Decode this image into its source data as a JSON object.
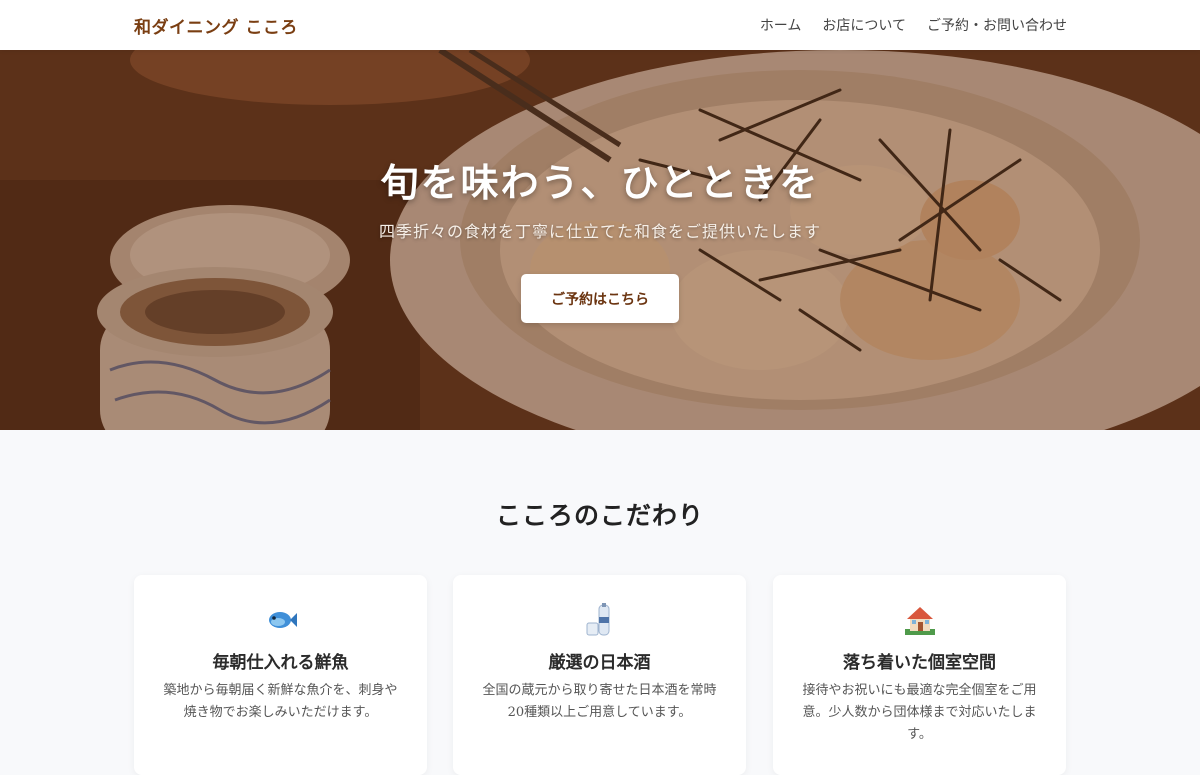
{
  "header": {
    "logo": "和ダイニング こころ",
    "nav": [
      {
        "label": "ホーム"
      },
      {
        "label": "お店について"
      },
      {
        "label": "ご予約・お問い合わせ"
      }
    ]
  },
  "hero": {
    "title": "旬を味わう、ひとときを",
    "subtitle": "四季折々の食材を丁寧に仕立てた和食をご提供いたします",
    "cta": "ご予約はこちら"
  },
  "features": {
    "title": "こころのこだわり",
    "items": [
      {
        "icon": "fish-icon",
        "title": "毎朝仕入れる鮮魚",
        "text": "築地から毎朝届く新鮮な魚介を、刺身や焼き物でお楽しみいただけます。"
      },
      {
        "icon": "sake-icon",
        "title": "厳選の日本酒",
        "text": "全国の蔵元から取り寄せた日本酒を常時20種類以上ご用意しています。"
      },
      {
        "icon": "house-icon",
        "title": "落ち着いた個室空間",
        "text": "接待やお祝いにも最適な完全個室をご用意。少人数から団体様まで対応いたします。"
      }
    ]
  },
  "colors": {
    "accent": "#7a3e12",
    "hero_overlay": "#6e3719",
    "background": "#f8f9fb"
  }
}
